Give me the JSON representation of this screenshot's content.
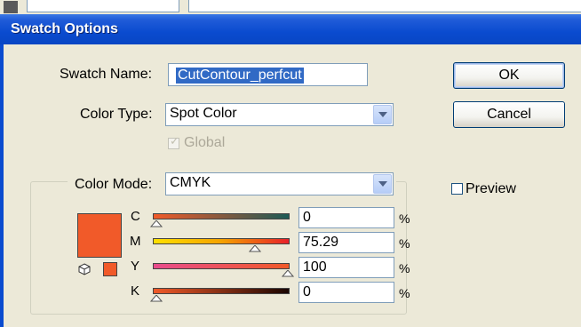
{
  "dialog": {
    "title": "Swatch Options"
  },
  "swatch_name": {
    "label": "Swatch Name:",
    "value": "CutContour_perfcut"
  },
  "color_type": {
    "label": "Color Type:",
    "value": "Spot Color"
  },
  "global": {
    "label": "Global",
    "checked": true,
    "disabled": true
  },
  "color_mode": {
    "label": "Color Mode:",
    "value": "CMYK"
  },
  "buttons": {
    "ok": "OK",
    "cancel": "Cancel"
  },
  "preview": {
    "label": "Preview",
    "checked": false
  },
  "swatch_color": "#F15A29",
  "channels": [
    {
      "label": "C",
      "value": "0",
      "unit": "%",
      "level": 0
    },
    {
      "label": "M",
      "value": "75.29",
      "unit": "%",
      "level": 0.7529
    },
    {
      "label": "Y",
      "value": "100",
      "unit": "%",
      "level": 1.0
    },
    {
      "label": "K",
      "value": "0",
      "unit": "%",
      "level": 0
    }
  ]
}
